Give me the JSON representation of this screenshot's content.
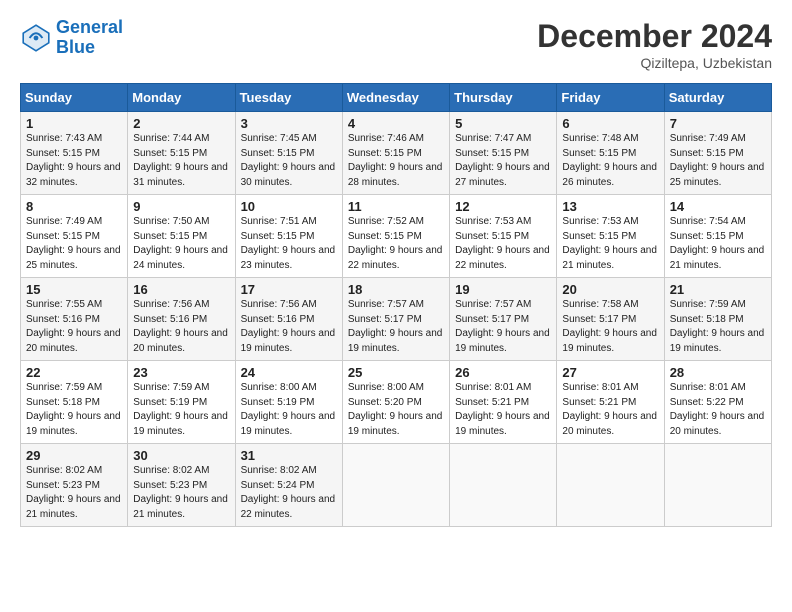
{
  "logo": {
    "line1": "General",
    "line2": "Blue"
  },
  "title": "December 2024",
  "location": "Qiziltepa, Uzbekistan",
  "days_of_week": [
    "Sunday",
    "Monday",
    "Tuesday",
    "Wednesday",
    "Thursday",
    "Friday",
    "Saturday"
  ],
  "weeks": [
    [
      {
        "day": 1,
        "sunrise": "7:43 AM",
        "sunset": "5:15 PM",
        "daylight": "9 hours and 32 minutes."
      },
      {
        "day": 2,
        "sunrise": "7:44 AM",
        "sunset": "5:15 PM",
        "daylight": "9 hours and 31 minutes."
      },
      {
        "day": 3,
        "sunrise": "7:45 AM",
        "sunset": "5:15 PM",
        "daylight": "9 hours and 30 minutes."
      },
      {
        "day": 4,
        "sunrise": "7:46 AM",
        "sunset": "5:15 PM",
        "daylight": "9 hours and 28 minutes."
      },
      {
        "day": 5,
        "sunrise": "7:47 AM",
        "sunset": "5:15 PM",
        "daylight": "9 hours and 27 minutes."
      },
      {
        "day": 6,
        "sunrise": "7:48 AM",
        "sunset": "5:15 PM",
        "daylight": "9 hours and 26 minutes."
      },
      {
        "day": 7,
        "sunrise": "7:49 AM",
        "sunset": "5:15 PM",
        "daylight": "9 hours and 25 minutes."
      }
    ],
    [
      {
        "day": 8,
        "sunrise": "7:49 AM",
        "sunset": "5:15 PM",
        "daylight": "9 hours and 25 minutes."
      },
      {
        "day": 9,
        "sunrise": "7:50 AM",
        "sunset": "5:15 PM",
        "daylight": "9 hours and 24 minutes."
      },
      {
        "day": 10,
        "sunrise": "7:51 AM",
        "sunset": "5:15 PM",
        "daylight": "9 hours and 23 minutes."
      },
      {
        "day": 11,
        "sunrise": "7:52 AM",
        "sunset": "5:15 PM",
        "daylight": "9 hours and 22 minutes."
      },
      {
        "day": 12,
        "sunrise": "7:53 AM",
        "sunset": "5:15 PM",
        "daylight": "9 hours and 22 minutes."
      },
      {
        "day": 13,
        "sunrise": "7:53 AM",
        "sunset": "5:15 PM",
        "daylight": "9 hours and 21 minutes."
      },
      {
        "day": 14,
        "sunrise": "7:54 AM",
        "sunset": "5:15 PM",
        "daylight": "9 hours and 21 minutes."
      }
    ],
    [
      {
        "day": 15,
        "sunrise": "7:55 AM",
        "sunset": "5:16 PM",
        "daylight": "9 hours and 20 minutes."
      },
      {
        "day": 16,
        "sunrise": "7:56 AM",
        "sunset": "5:16 PM",
        "daylight": "9 hours and 20 minutes."
      },
      {
        "day": 17,
        "sunrise": "7:56 AM",
        "sunset": "5:16 PM",
        "daylight": "9 hours and 19 minutes."
      },
      {
        "day": 18,
        "sunrise": "7:57 AM",
        "sunset": "5:17 PM",
        "daylight": "9 hours and 19 minutes."
      },
      {
        "day": 19,
        "sunrise": "7:57 AM",
        "sunset": "5:17 PM",
        "daylight": "9 hours and 19 minutes."
      },
      {
        "day": 20,
        "sunrise": "7:58 AM",
        "sunset": "5:17 PM",
        "daylight": "9 hours and 19 minutes."
      },
      {
        "day": 21,
        "sunrise": "7:59 AM",
        "sunset": "5:18 PM",
        "daylight": "9 hours and 19 minutes."
      }
    ],
    [
      {
        "day": 22,
        "sunrise": "7:59 AM",
        "sunset": "5:18 PM",
        "daylight": "9 hours and 19 minutes."
      },
      {
        "day": 23,
        "sunrise": "7:59 AM",
        "sunset": "5:19 PM",
        "daylight": "9 hours and 19 minutes."
      },
      {
        "day": 24,
        "sunrise": "8:00 AM",
        "sunset": "5:19 PM",
        "daylight": "9 hours and 19 minutes."
      },
      {
        "day": 25,
        "sunrise": "8:00 AM",
        "sunset": "5:20 PM",
        "daylight": "9 hours and 19 minutes."
      },
      {
        "day": 26,
        "sunrise": "8:01 AM",
        "sunset": "5:21 PM",
        "daylight": "9 hours and 19 minutes."
      },
      {
        "day": 27,
        "sunrise": "8:01 AM",
        "sunset": "5:21 PM",
        "daylight": "9 hours and 20 minutes."
      },
      {
        "day": 28,
        "sunrise": "8:01 AM",
        "sunset": "5:22 PM",
        "daylight": "9 hours and 20 minutes."
      }
    ],
    [
      {
        "day": 29,
        "sunrise": "8:02 AM",
        "sunset": "5:23 PM",
        "daylight": "9 hours and 21 minutes."
      },
      {
        "day": 30,
        "sunrise": "8:02 AM",
        "sunset": "5:23 PM",
        "daylight": "9 hours and 21 minutes."
      },
      {
        "day": 31,
        "sunrise": "8:02 AM",
        "sunset": "5:24 PM",
        "daylight": "9 hours and 22 minutes."
      },
      null,
      null,
      null,
      null
    ]
  ]
}
